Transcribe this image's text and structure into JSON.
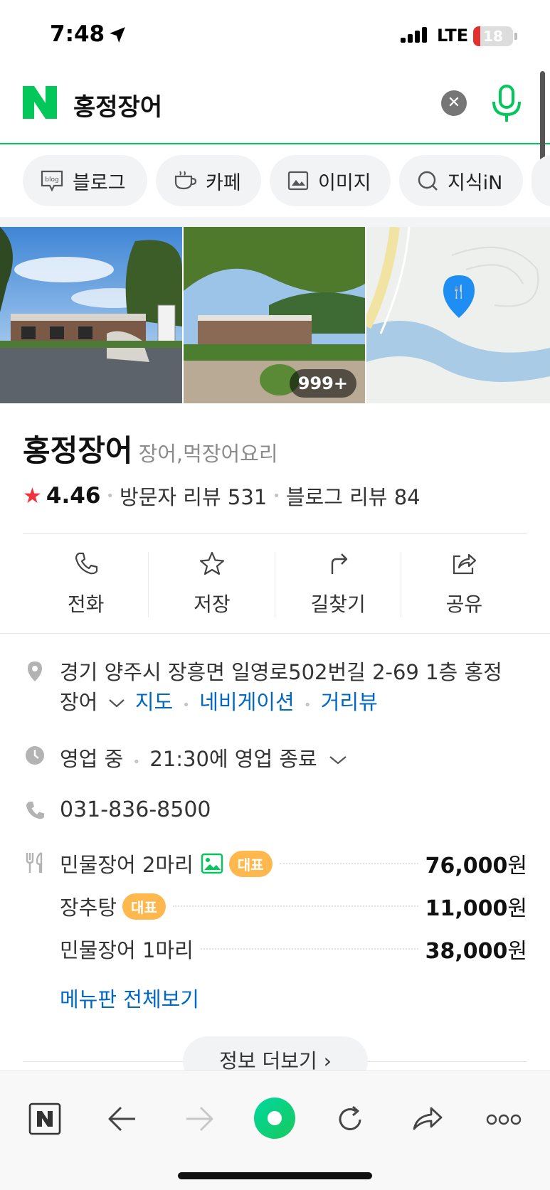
{
  "status_bar": {
    "time": "7:48",
    "network": "LTE",
    "battery": "18",
    "battery_level": 0.18
  },
  "search": {
    "query": "홍정장어",
    "clear_icon": "close-icon",
    "mic_icon": "mic-icon"
  },
  "chips": [
    {
      "label": "블로그",
      "icon": "blog-icon"
    },
    {
      "label": "카페",
      "icon": "cafe-cup-icon"
    },
    {
      "label": "이미지",
      "icon": "image-icon"
    },
    {
      "label": "지식iN",
      "icon": "kin-icon"
    }
  ],
  "photos": {
    "count_badge": "999+"
  },
  "place": {
    "name": "홍정장어",
    "category": "장어,먹장어요리",
    "rating": "4.46",
    "visitor_reviews": "방문자 리뷰 531",
    "blog_reviews": "블로그 리뷰 84"
  },
  "actions": [
    {
      "label": "전화",
      "icon": "phone-icon"
    },
    {
      "label": "저장",
      "icon": "star-icon"
    },
    {
      "label": "길찾기",
      "icon": "directions-icon"
    },
    {
      "label": "공유",
      "icon": "share-icon"
    }
  ],
  "info": {
    "address_line1": "경기 양주시 장흥면 일영로502번길 2-69 1층 홍정",
    "address_line2": "장어",
    "links": [
      "지도",
      "네비게이션",
      "거리뷰"
    ],
    "status": "영업 중",
    "hours": "21:30에 영업 종료",
    "phone": "031-836-8500"
  },
  "menu": {
    "items": [
      {
        "name": "민물장어 2마리",
        "tag": "대표",
        "price": "76,000",
        "currency": "원"
      },
      {
        "name": "장추탕",
        "tag": "대표",
        "price": "11,000",
        "currency": "원"
      },
      {
        "name": "민물장어 1마리",
        "tag": "",
        "price": "38,000",
        "currency": "원"
      }
    ],
    "view_all": "메뉴판 전체보기"
  },
  "more_button": "정보 더보기 ›",
  "colors": {
    "accent": "#03c75a",
    "link": "#0068c3",
    "tag": "#ffb84d",
    "star": "#f0323c"
  }
}
